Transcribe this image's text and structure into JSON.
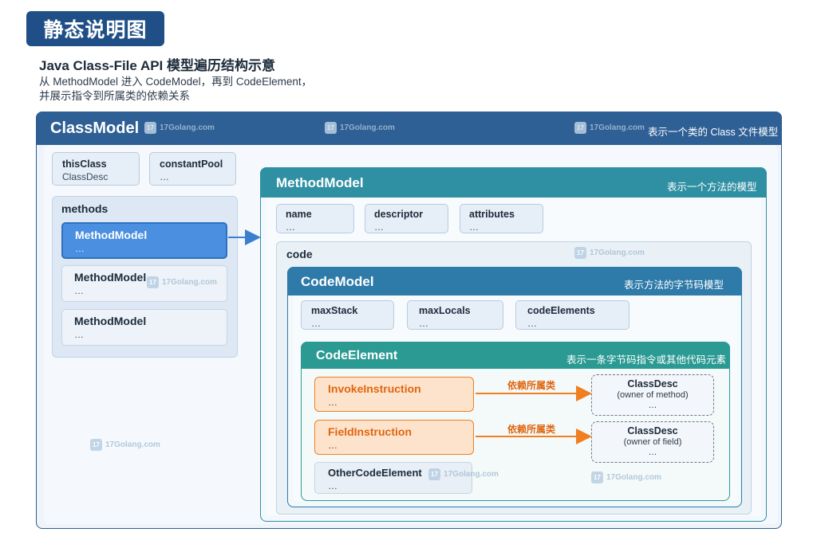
{
  "badge": "静态说明图",
  "heading": "Java Class-File API 模型遍历结构示意",
  "subtitle_line1": "从 MethodModel 进入 CodeModel，再到 CodeElement，",
  "subtitle_line2": "并展示指令到所属类的依赖关系",
  "class_model": {
    "title": "ClassModel",
    "desc": "表示一个类的 Class 文件模型",
    "this_class": {
      "name": "thisClass",
      "value": "ClassDesc"
    },
    "constant_pool": {
      "name": "constantPool",
      "value": "…"
    },
    "methods": {
      "label": "methods",
      "items": [
        {
          "name": "MethodModel",
          "value": "…"
        },
        {
          "name": "MethodModel",
          "value": "…"
        },
        {
          "name": "MethodModel",
          "value": "…"
        }
      ]
    }
  },
  "method_model": {
    "title": "MethodModel",
    "desc": "表示一个方法的模型",
    "fields": [
      {
        "name": "name",
        "value": "…"
      },
      {
        "name": "descriptor",
        "value": "…"
      },
      {
        "name": "attributes",
        "value": "…"
      }
    ],
    "code_label": "code"
  },
  "code_model": {
    "title": "CodeModel",
    "desc": "表示方法的字节码模型",
    "fields": [
      {
        "name": "maxStack",
        "value": "…"
      },
      {
        "name": "maxLocals",
        "value": "…"
      },
      {
        "name": "codeElements",
        "value": "…"
      }
    ]
  },
  "code_element": {
    "title": "CodeElement",
    "desc": "表示一条字节码指令或其他代码元素",
    "invoke": {
      "name": "InvokeInstruction",
      "value": "…"
    },
    "field": {
      "name": "FieldInstruction",
      "value": "…"
    },
    "other": {
      "name": "OtherCodeElement",
      "value": "…"
    },
    "dep_label": "依赖所属类",
    "classdesc_method": {
      "name": "ClassDesc",
      "note": "(owner of method)",
      "value": "…"
    },
    "classdesc_field": {
      "name": "ClassDesc",
      "note": "(owner of field)",
      "value": "…"
    }
  },
  "watermark": "17Golang.com",
  "colors": {
    "class_model": "#2e5f95",
    "method_model": "#2f8fa3",
    "code_model": "#2e7aa8",
    "code_element": "#2a9a93",
    "instruction": "#f07f22"
  }
}
